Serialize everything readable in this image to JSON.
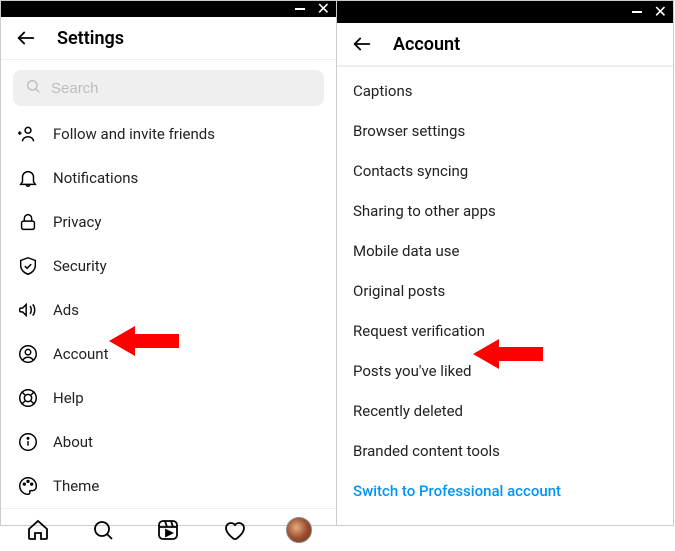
{
  "left": {
    "title": "Settings",
    "search_placeholder": "Search",
    "items": [
      {
        "label": "Follow and invite friends"
      },
      {
        "label": "Notifications"
      },
      {
        "label": "Privacy"
      },
      {
        "label": "Security"
      },
      {
        "label": "Ads"
      },
      {
        "label": "Account"
      },
      {
        "label": "Help"
      },
      {
        "label": "About"
      },
      {
        "label": "Theme"
      }
    ]
  },
  "right": {
    "title": "Account",
    "items": [
      {
        "label": "Captions"
      },
      {
        "label": "Browser settings"
      },
      {
        "label": "Contacts syncing"
      },
      {
        "label": "Sharing to other apps"
      },
      {
        "label": "Mobile data use"
      },
      {
        "label": "Original posts"
      },
      {
        "label": "Request verification"
      },
      {
        "label": "Posts you've liked"
      },
      {
        "label": "Recently deleted"
      },
      {
        "label": "Branded content tools"
      }
    ],
    "cta": "Switch to Professional account"
  }
}
